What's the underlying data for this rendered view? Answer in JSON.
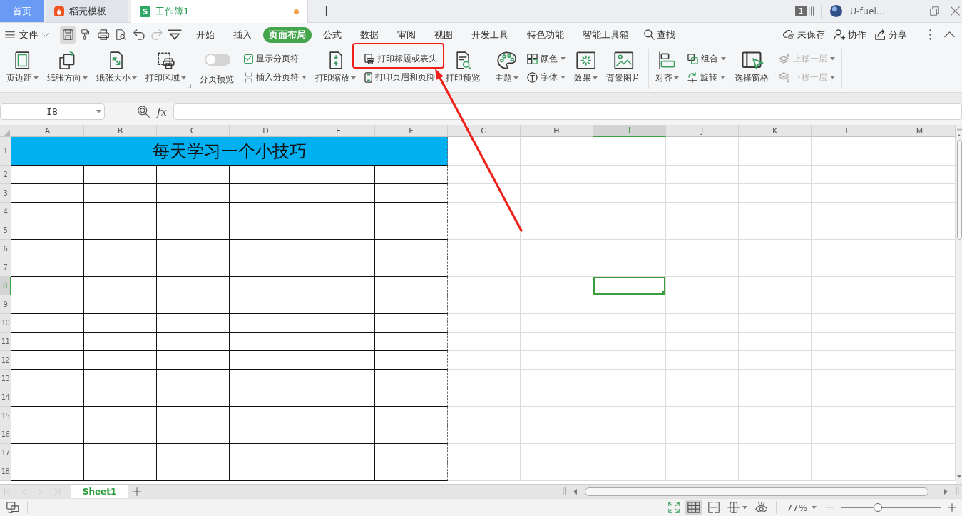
{
  "title_bar": {
    "tabs": [
      {
        "kind": "home",
        "label": "首页",
        "selected": false,
        "modified": false
      },
      {
        "kind": "docer",
        "label": "稻壳模板",
        "selected": false,
        "modified": false
      },
      {
        "kind": "sheet",
        "logo": "S",
        "label": "工作簿1",
        "selected": true,
        "modified": true
      }
    ],
    "window_count": "1",
    "user": "U-fuel..."
  },
  "menu_bar": {
    "file": "文件",
    "quick_access": [
      {
        "kind": "save",
        "highlighted": true,
        "disabled": false
      },
      {
        "kind": "format_painter",
        "highlighted": false,
        "disabled": false
      },
      {
        "kind": "print",
        "highlighted": false,
        "disabled": false
      },
      {
        "kind": "print_preview",
        "highlighted": false,
        "disabled": false
      },
      {
        "kind": "undo",
        "highlighted": false,
        "disabled": false
      },
      {
        "kind": "redo",
        "highlighted": false,
        "disabled": true
      },
      {
        "kind": "customize",
        "highlighted": false,
        "disabled": false
      }
    ],
    "tabs": [
      {
        "label": "开始",
        "selected": false
      },
      {
        "label": "插入",
        "selected": false
      },
      {
        "label": "页面布局",
        "selected": true
      },
      {
        "label": "公式",
        "selected": false
      },
      {
        "label": "数据",
        "selected": false
      },
      {
        "label": "审阅",
        "selected": false
      },
      {
        "label": "视图",
        "selected": false
      },
      {
        "label": "开发工具",
        "selected": false
      },
      {
        "label": "特色功能",
        "selected": false
      },
      {
        "label": "智能工具箱",
        "selected": false
      }
    ],
    "search": "查找",
    "actions": [
      {
        "kind": "save_status",
        "label": "未保存"
      },
      {
        "kind": "collaborate",
        "label": "协作"
      },
      {
        "kind": "share",
        "label": "分享"
      }
    ]
  },
  "ribbon": {
    "groups": [
      {
        "launcher": true,
        "items": [
          {
            "kind": "large",
            "label": "页边距",
            "dropdown": true,
            "disabled": false,
            "callout": false
          },
          {
            "kind": "large",
            "label": "纸张方向",
            "dropdown": true,
            "disabled": false,
            "callout": false
          },
          {
            "kind": "large",
            "label": "纸张大小",
            "dropdown": true,
            "disabled": false,
            "callout": false
          },
          {
            "kind": "large",
            "label": "打印区域",
            "dropdown": true,
            "disabled": false,
            "callout": false
          }
        ]
      },
      {
        "launcher": false,
        "items": [
          {
            "kind": "toggle",
            "label": "分页预览",
            "on": false,
            "dropdown": false,
            "disabled": false,
            "callout": false
          },
          {
            "kind": "checkbox",
            "label": "显示分页符",
            "checked": true,
            "dropdown": false,
            "disabled": false,
            "callout": false
          },
          {
            "kind": "small",
            "label": "插入分页符",
            "dropdown": true,
            "disabled": false,
            "callout": false
          },
          {
            "kind": "large",
            "label": "打印缩放",
            "dropdown": true,
            "disabled": false,
            "callout": false
          },
          {
            "kind": "small",
            "label": "打印标题或表头",
            "dropdown": false,
            "disabled": false,
            "callout": true
          },
          {
            "kind": "small",
            "label": "打印页眉和页脚",
            "dropdown": false,
            "disabled": false,
            "callout": false
          },
          {
            "kind": "large",
            "label": "打印预览",
            "dropdown": false,
            "disabled": false,
            "callout": false
          }
        ]
      },
      {
        "launcher": false,
        "items": [
          {
            "kind": "large",
            "label": "主题",
            "dropdown": true,
            "disabled": false,
            "callout": false
          },
          {
            "kind": "small",
            "label": "颜色",
            "dropdown": true,
            "disabled": false,
            "callout": false
          },
          {
            "kind": "small",
            "label": "字体",
            "dropdown": true,
            "disabled": false,
            "callout": false
          },
          {
            "kind": "large",
            "label": "效果",
            "dropdown": true,
            "disabled": false,
            "callout": false
          },
          {
            "kind": "large",
            "label": "背景图片",
            "dropdown": false,
            "disabled": false,
            "callout": false
          }
        ]
      },
      {
        "launcher": false,
        "items": [
          {
            "kind": "large",
            "label": "对齐",
            "dropdown": true,
            "disabled": false,
            "callout": false
          },
          {
            "kind": "small",
            "label": "组合",
            "dropdown": true,
            "disabled": false,
            "callout": false
          },
          {
            "kind": "small",
            "label": "旋转",
            "dropdown": true,
            "disabled": false,
            "callout": false
          },
          {
            "kind": "large",
            "label": "选择窗格",
            "dropdown": false,
            "disabled": false,
            "callout": false
          },
          {
            "kind": "small",
            "label": "上移一层",
            "dropdown": true,
            "disabled": true,
            "callout": false
          },
          {
            "kind": "small",
            "label": "下移一层",
            "dropdown": true,
            "disabled": true,
            "callout": false
          }
        ]
      }
    ]
  },
  "formula_bar": {
    "name_box": "I8",
    "fx": "fx"
  },
  "sheet": {
    "columns": [
      {
        "label": "A",
        "selected": false,
        "page_break": false
      },
      {
        "label": "B",
        "selected": false,
        "page_break": false
      },
      {
        "label": "C",
        "selected": false,
        "page_break": false
      },
      {
        "label": "D",
        "selected": false,
        "page_break": false
      },
      {
        "label": "E",
        "selected": false,
        "page_break": false
      },
      {
        "label": "F",
        "selected": false,
        "page_break": true
      },
      {
        "label": "G",
        "selected": false,
        "page_break": false
      },
      {
        "label": "H",
        "selected": false,
        "page_break": false
      },
      {
        "label": "I",
        "selected": true,
        "page_break": false
      },
      {
        "label": "J",
        "selected": false,
        "page_break": false
      },
      {
        "label": "K",
        "selected": false,
        "page_break": false
      },
      {
        "label": "L",
        "selected": false,
        "page_break": true
      },
      {
        "label": "M",
        "selected": false,
        "page_break": false
      }
    ],
    "rows": [
      {
        "label": "1",
        "selected": false
      },
      {
        "label": "2",
        "selected": false
      },
      {
        "label": "3",
        "selected": false
      },
      {
        "label": "4",
        "selected": false
      },
      {
        "label": "5",
        "selected": false
      },
      {
        "label": "6",
        "selected": false
      },
      {
        "label": "7",
        "selected": false
      },
      {
        "label": "8",
        "selected": true
      },
      {
        "label": "9",
        "selected": false
      },
      {
        "label": "10",
        "selected": false
      },
      {
        "label": "11",
        "selected": false
      },
      {
        "label": "12",
        "selected": false
      },
      {
        "label": "13",
        "selected": false
      },
      {
        "label": "14",
        "selected": false
      },
      {
        "label": "15",
        "selected": false
      },
      {
        "label": "16",
        "selected": false
      },
      {
        "label": "17",
        "selected": false
      },
      {
        "label": "18",
        "selected": false
      }
    ],
    "title": "每天学习一个小技巧"
  },
  "sheet_tabs": [
    {
      "label": "Sheet1",
      "selected": true
    }
  ],
  "status_bar": {
    "views": [
      {
        "kind": "fullscreen",
        "selected": false,
        "dropdown": false
      },
      {
        "kind": "normal",
        "selected": true,
        "dropdown": false
      },
      {
        "kind": "page_break",
        "selected": false,
        "dropdown": false
      },
      {
        "kind": "reading",
        "selected": false,
        "dropdown": true
      },
      {
        "kind": "eye_care",
        "selected": false,
        "dropdown": false
      }
    ],
    "zoom": {
      "label": "77%",
      "level": 0.36
    }
  }
}
